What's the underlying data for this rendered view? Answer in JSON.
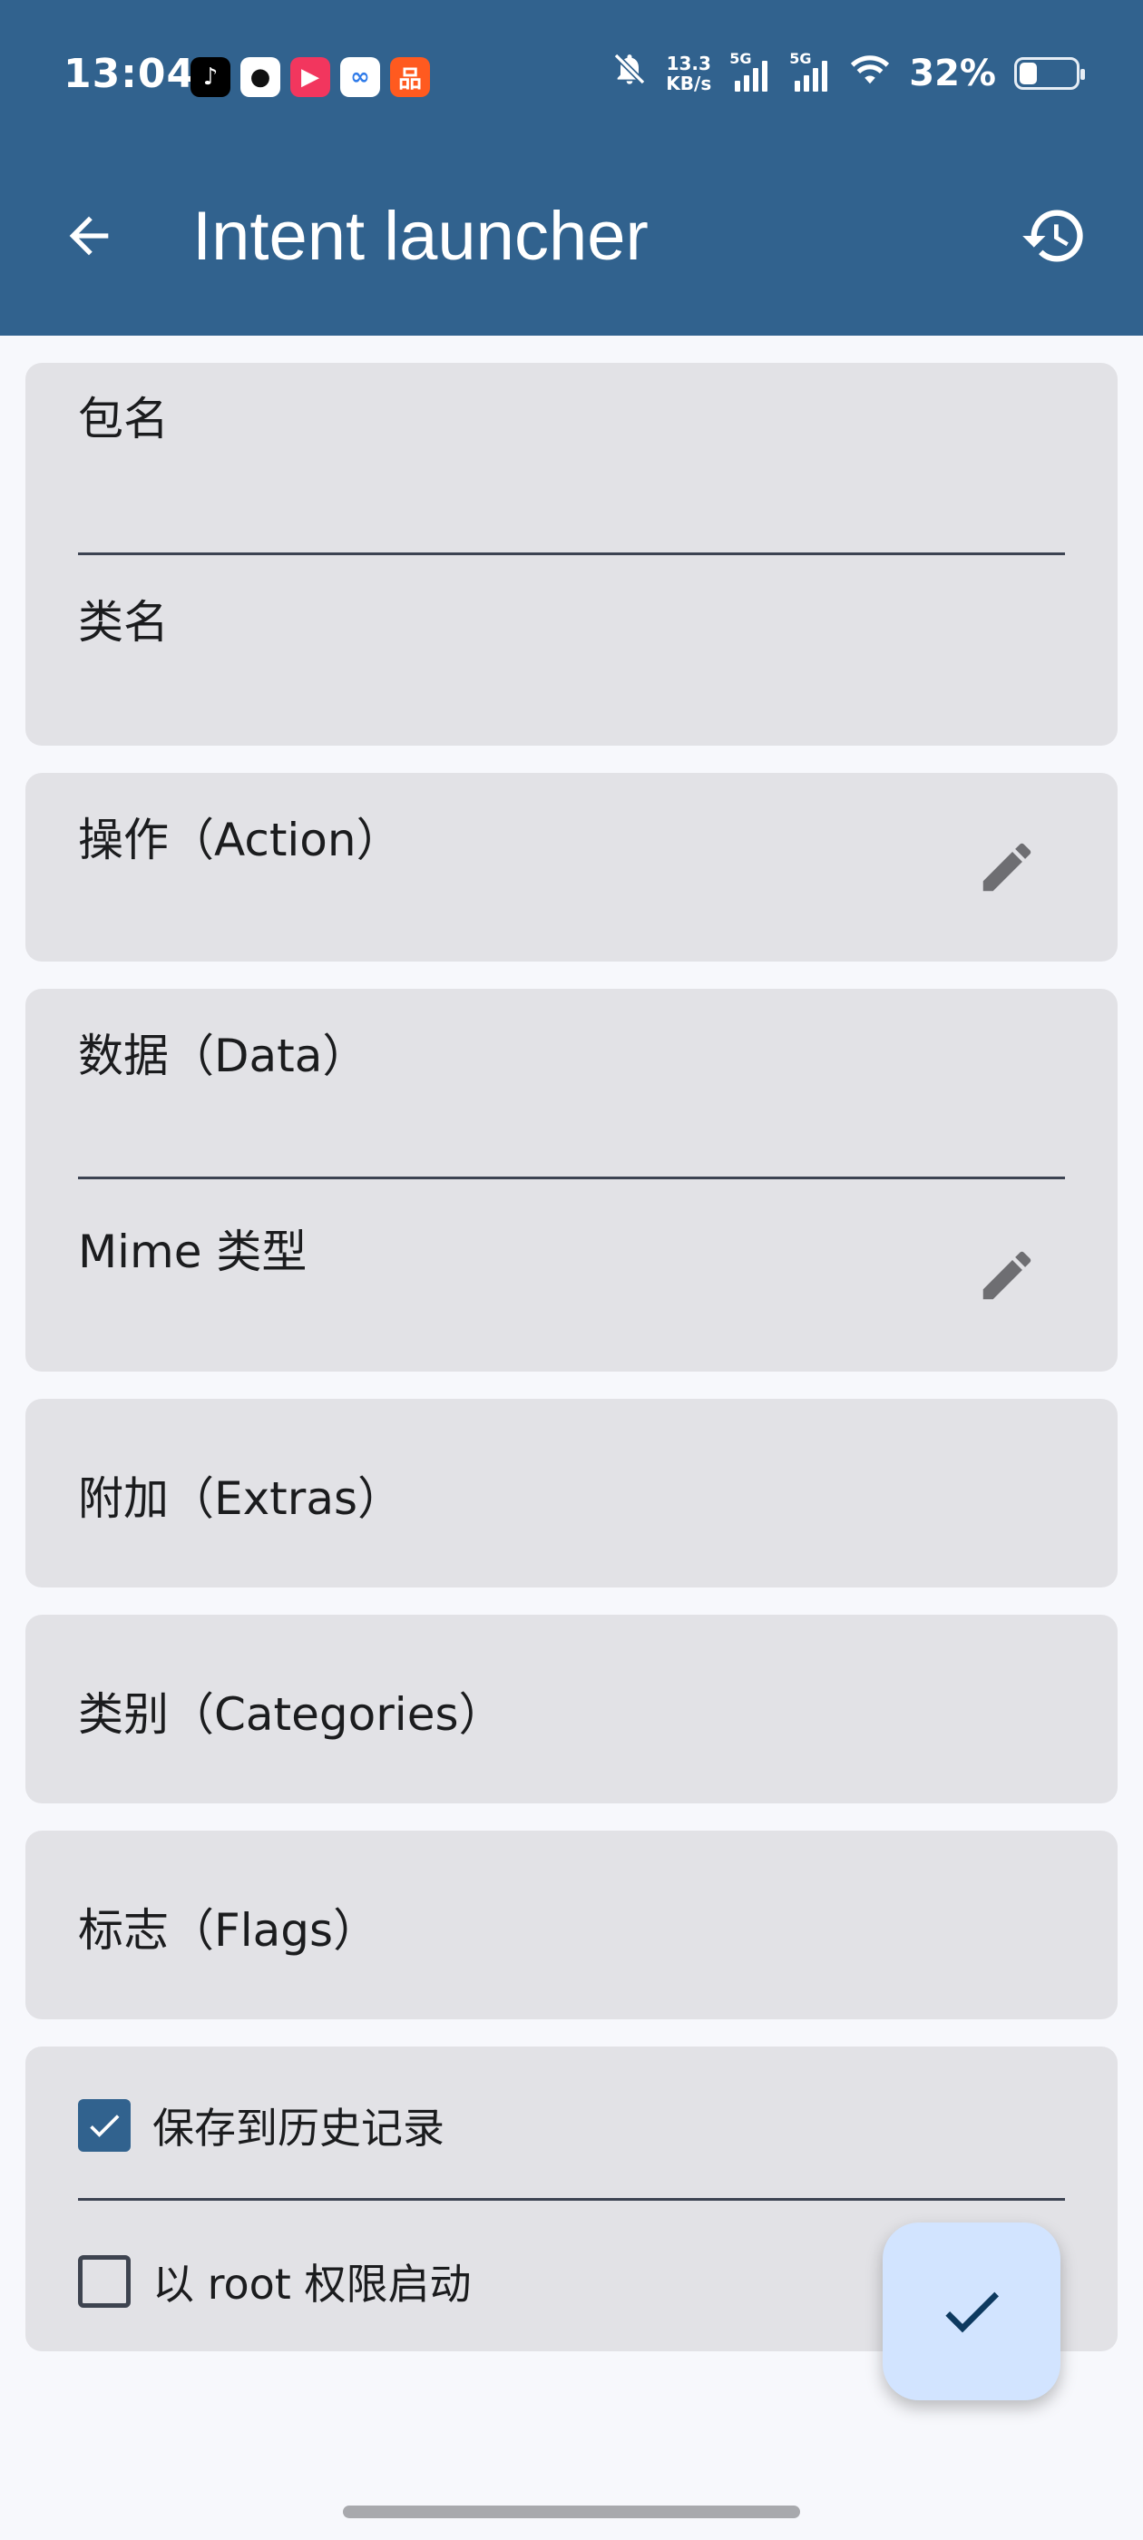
{
  "status_bar": {
    "time": "13:04",
    "app_icons": [
      {
        "name": "tiktok-icon",
        "glyph": "♪",
        "bg": "#000000",
        "fg": "#ffffff"
      },
      {
        "name": "qq-icon",
        "glyph": "●",
        "bg": "#ffffff",
        "fg": "#111111"
      },
      {
        "name": "video-app-icon",
        "glyph": "▶",
        "bg": "#f2365e",
        "fg": "#ffffff"
      },
      {
        "name": "cloud-app-icon",
        "glyph": "∞",
        "bg": "#ffffff",
        "fg": "#2f7be9"
      },
      {
        "name": "shop-app-icon",
        "glyph": "品",
        "bg": "#ff5a1f",
        "fg": "#ffffff"
      }
    ],
    "net_speed_value": "13.3",
    "net_speed_unit": "KB/s",
    "signal1_label": "5G",
    "signal2_label": "5G",
    "battery_percent": "32%",
    "battery_level": 0.32
  },
  "appbar": {
    "title": "Intent launcher",
    "color": "#31628e"
  },
  "form": {
    "package_label": "包名",
    "class_label": "类名",
    "action_label": "操作（Action）",
    "data_label": "数据（Data）",
    "mime_label": "Mime 类型",
    "extras_label": "附加（Extras）",
    "categories_label": "类别（Categories）",
    "flags_label": "标志（Flags）",
    "save_history_label": "保存到历史记录",
    "save_history_checked": true,
    "root_label": "以 root 权限启动",
    "root_checked": false
  },
  "colors": {
    "card_bg": "#e2e2e6",
    "page_bg": "#f7f8fc",
    "fab_bg": "#d2e4ff",
    "accent": "#31628e"
  }
}
